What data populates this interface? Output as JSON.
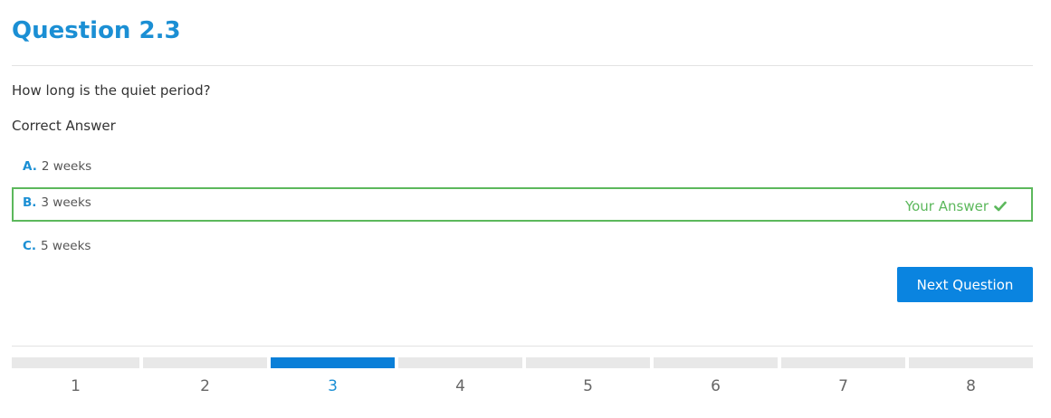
{
  "question": {
    "title": "Question 2.3",
    "prompt": "How long is the quiet period?",
    "status_label": "Correct Answer"
  },
  "options": [
    {
      "letter": "A.",
      "text": "2 weeks"
    },
    {
      "letter": "B.",
      "text": "3 weeks",
      "selected": true,
      "tag": "Your Answer"
    },
    {
      "letter": "C.",
      "text": "5 weeks"
    }
  ],
  "actions": {
    "next_label": "Next Question"
  },
  "pagination": {
    "pages": [
      "1",
      "2",
      "3",
      "4",
      "5",
      "6",
      "7",
      "8"
    ],
    "current": "3"
  },
  "colors": {
    "accent": "#1b8fd4",
    "correct": "#5cb85c",
    "button": "#0a84e0",
    "inactive_bar": "#e8e8e8"
  },
  "icons": {
    "selected_answer": "check-icon"
  }
}
